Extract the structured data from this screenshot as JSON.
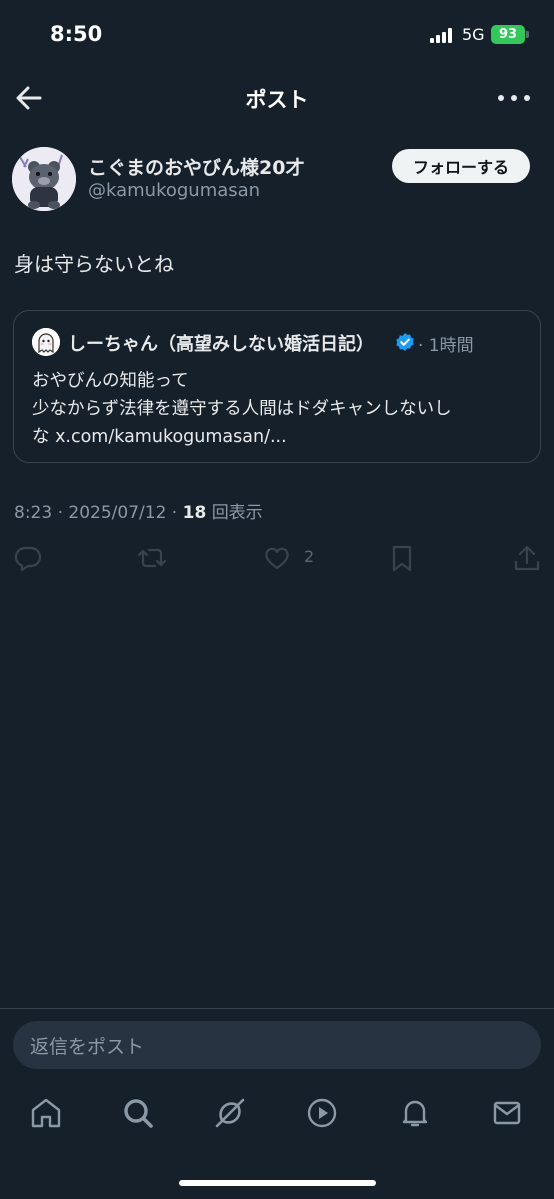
{
  "status": {
    "time": "8:50",
    "network": "5G",
    "battery": "93"
  },
  "nav": {
    "title": "ポスト"
  },
  "author": {
    "name": "こぐまのおやびん様20才",
    "handle": "@kamukogumasan",
    "follow_label": "フォローする"
  },
  "post": {
    "text": "身は守らないとね"
  },
  "quote": {
    "name": "しーちゃん（高望みしない婚活日記）",
    "time": "· 1時間",
    "lines": [
      "おやびんの知能って",
      "少なからず法律を遵守する人間はドダキャンしないし",
      "な x.com/kamukogumasan/..."
    ]
  },
  "meta": {
    "time": "8:23",
    "date": "2025/07/12",
    "views": "18",
    "views_label": "回表示"
  },
  "actions": {
    "like_count": "2"
  },
  "reply": {
    "placeholder": "返信をポスト"
  },
  "icons": [
    "back-arrow-icon",
    "more-icon",
    "reply-icon",
    "repost-icon",
    "like-icon",
    "bookmark-icon",
    "share-icon",
    "home-icon",
    "search-icon",
    "grok-icon",
    "video-icon",
    "bell-icon",
    "mail-icon",
    "verified-badge-icon"
  ],
  "colors": {
    "background": "#15202b",
    "accent": "#1d9bf0",
    "battery": "#34c759"
  }
}
